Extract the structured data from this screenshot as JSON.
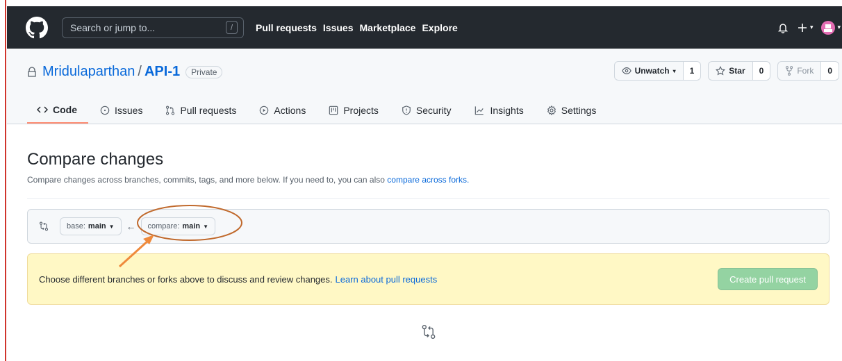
{
  "header": {
    "search_placeholder": "Search or jump to...",
    "search_key": "/",
    "nav": [
      "Pull requests",
      "Issues",
      "Marketplace",
      "Explore"
    ]
  },
  "repo": {
    "owner": "Mridulaparthan",
    "separator": "/",
    "name": "API-1",
    "visibility": "Private",
    "watch_label": "Unwatch",
    "watch_count": "1",
    "star_label": "Star",
    "star_count": "0",
    "fork_label": "Fork",
    "fork_count": "0"
  },
  "tabs": [
    {
      "label": "Code",
      "icon": "code-icon"
    },
    {
      "label": "Issues",
      "icon": "issue-icon"
    },
    {
      "label": "Pull requests",
      "icon": "pull-request-icon"
    },
    {
      "label": "Actions",
      "icon": "play-icon"
    },
    {
      "label": "Projects",
      "icon": "project-icon"
    },
    {
      "label": "Security",
      "icon": "shield-icon"
    },
    {
      "label": "Insights",
      "icon": "graph-icon"
    },
    {
      "label": "Settings",
      "icon": "gear-icon"
    }
  ],
  "compare": {
    "title": "Compare changes",
    "subtitle": "Compare changes across branches, commits, tags, and more below. If you need to, you can also",
    "subtitle_link": "compare across forks.",
    "base_prefix": "base:",
    "base_value": "main",
    "compare_prefix": "compare:",
    "compare_value": "main",
    "flash_text": "Choose different branches or forks above to discuss and review changes.",
    "flash_link": "Learn about pull requests",
    "create_button": "Create pull request"
  },
  "colors": {
    "header_bg": "#24292f",
    "link": "#0969da",
    "annotation": "#c0692c",
    "flash_bg": "#fff8c5",
    "create_btn": "#94d3a2"
  }
}
